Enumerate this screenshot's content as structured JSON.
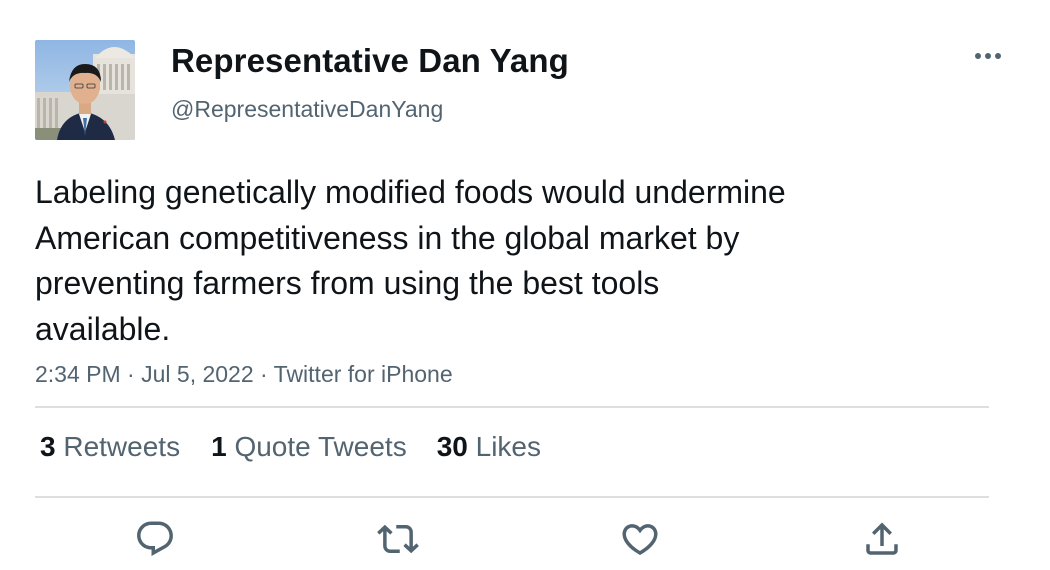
{
  "author": {
    "display_name": "Representative Dan Yang",
    "handle": "@RepresentativeDanYang"
  },
  "tweet": {
    "lines": [
      "Labeling genetically modified foods would undermine",
      "American competitiveness in the global market by",
      "preventing farmers from using the best tools",
      "available."
    ],
    "time": "2:34 PM",
    "sep1": " · ",
    "date": "Jul 5, 2022",
    "sep2": " · ",
    "source": "Twitter for iPhone"
  },
  "stats": {
    "retweets": {
      "count": "3",
      "label": "Retweets"
    },
    "quotes": {
      "count": "1",
      "label": "Quote Tweets"
    },
    "likes": {
      "count": "30",
      "label": "Likes"
    }
  },
  "icons": {
    "more": "more-horizontal-icon",
    "reply": "reply-icon",
    "retweet": "retweet-icon",
    "like": "heart-icon",
    "share": "share-icon"
  },
  "colors": {
    "text": "#0f1419",
    "secondary": "#536471",
    "icon": "#536471",
    "divider": "#dedede"
  }
}
